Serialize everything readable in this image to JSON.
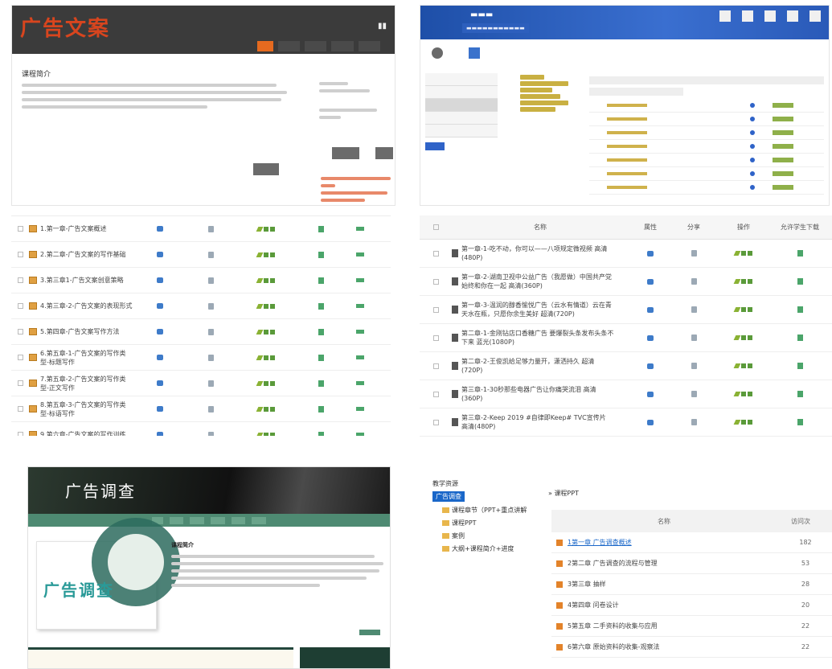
{
  "panelA": {
    "logo": "广告文案",
    "intro_title": "课程简介"
  },
  "panelC": {
    "rows": [
      {
        "name": "1.第一章-广告文案概述"
      },
      {
        "name": "2.第二章-广告文案的写作基础"
      },
      {
        "name": "3.第三章1-广告文案创意策略"
      },
      {
        "name": "4.第三章-2-广告文案的表现形式"
      },
      {
        "name": "5.第四章-广告文案写作方法"
      },
      {
        "name": "6.第五章-1-广告文案的写作类型-标题写作"
      },
      {
        "name": "7.第五章-2-广告文案的写作类型-正文写作"
      },
      {
        "name": "8.第五章-3-广告文案的写作类型-标语写作"
      },
      {
        "name": "9.第六章-广告文案的写作训练"
      }
    ]
  },
  "panelD": {
    "headers": {
      "name": "名称",
      "attr": "属性",
      "share": "分享",
      "ops": "操作",
      "allow": "允许学生下载"
    },
    "rows": [
      {
        "name": "第一章-1-吃不动，你可以——八项规定微视频 高清(480P)"
      },
      {
        "name": "第一章-2-湖南卫视中公益广告（我愿做）中国共产党始终和你在一起 高清(360P)"
      },
      {
        "name": "第一章-3-温润的醇香愉悦广告（云水有情道）云在青天水在瓶，只愿你余生美好 超清(720P)"
      },
      {
        "name": "第二章-1-金刚钻店口香糖广告 要爆裂头条发布头条不下来 蓝光(1080P)"
      },
      {
        "name": "第二章-2-王俊凯给足够力量开，潇洒持久 超清(720P)"
      },
      {
        "name": "第三章-1-30秒那些电器广告让你痛哭流泪 高清(360P)"
      },
      {
        "name": "第三章-2-Keep 2019 #自律即Keep# TVC宣传片 高清(480P)"
      }
    ]
  },
  "panelE": {
    "title": "广告调查",
    "card_text": "广告调查",
    "intro_heading": "课程简介"
  },
  "panelF": {
    "tree_root": "教学资源",
    "tree_selected": "广告调查",
    "nodes": [
      "课程章节（PPT+重点讲解",
      "课程PPT",
      "案例",
      "大纲+课程简介+进度"
    ],
    "crumb": "» 课程PPT",
    "col_name": "名称",
    "col_visits": "访问次",
    "rows": [
      {
        "name": "1第一章 广告调查概述",
        "visits": "182",
        "link": true
      },
      {
        "name": "2第二章 广告调查的流程与管理",
        "visits": "53",
        "link": false
      },
      {
        "name": "3第三章 抽样",
        "visits": "28",
        "link": false
      },
      {
        "name": "4第四章 问卷设计",
        "visits": "20",
        "link": false
      },
      {
        "name": "5第五章 二手资料的收集与应用",
        "visits": "22",
        "link": false
      },
      {
        "name": "6第六章 原始资料的收集-观察法",
        "visits": "22",
        "link": false
      }
    ]
  },
  "colors": {
    "orange": "#e56a1f",
    "blue": "#1a67c9",
    "green": "#4e8a72",
    "folder": "#e0a042"
  }
}
